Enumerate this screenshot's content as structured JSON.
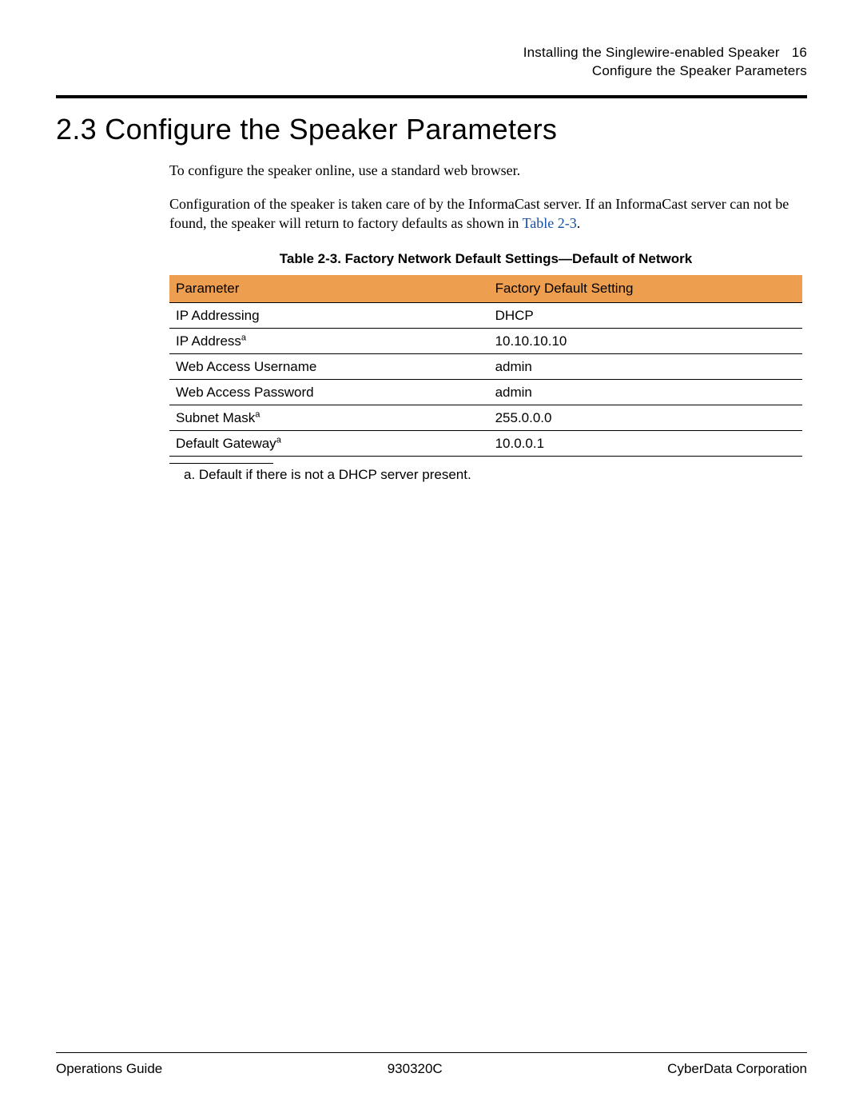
{
  "header": {
    "line1": "Installing the Singlewire-enabled Speaker",
    "page_number": "16",
    "line2": "Configure the Speaker Parameters"
  },
  "section": {
    "number": "2.3",
    "title": "Configure the Speaker Parameters"
  },
  "paragraphs": {
    "p1": "To configure the speaker online, use a standard web browser.",
    "p2a": "Configuration of the speaker is taken care of by the InformaCast server. If an InformaCast server can not be found, the speaker will return to factory defaults as shown in ",
    "p2_link": "Table 2-3",
    "p2b": "."
  },
  "table": {
    "caption": "Table 2-3. Factory Network Default Settings—Default of Network",
    "headers": {
      "col1": "Parameter",
      "col2": "Factory Default Setting"
    },
    "rows": [
      {
        "param": "IP Addressing",
        "sup": "",
        "value": "DHCP"
      },
      {
        "param": "IP Address",
        "sup": "a",
        "value": "10.10.10.10"
      },
      {
        "param": "Web Access Username",
        "sup": "",
        "value": "admin"
      },
      {
        "param": "Web Access Password",
        "sup": "",
        "value": "admin"
      },
      {
        "param": "Subnet Mask",
        "sup": "a",
        "value": "255.0.0.0"
      },
      {
        "param": "Default Gateway",
        "sup": "a",
        "value": "10.0.0.1"
      }
    ],
    "footnote": "a.  Default if there is not a DHCP server present."
  },
  "footer": {
    "left": "Operations Guide",
    "center": "930320C",
    "right": "CyberData Corporation"
  }
}
